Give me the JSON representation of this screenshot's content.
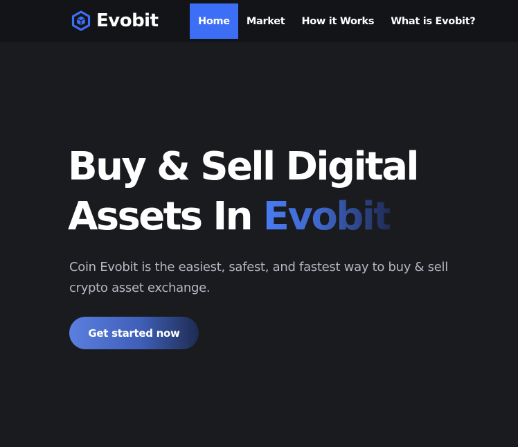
{
  "brand": {
    "name": "Evobit",
    "icon": "cube-icon",
    "accent_color": "#3d6ff6"
  },
  "nav": {
    "items": [
      {
        "label": "Home",
        "active": true
      },
      {
        "label": "Market",
        "active": false
      },
      {
        "label": "How it Works",
        "active": false
      },
      {
        "label": "What is Evobit?",
        "active": false
      }
    ]
  },
  "hero": {
    "title_line1": "Buy & Sell Digital",
    "title_line2_prefix": "Assets In ",
    "title_line2_accent": "Evobit",
    "description": "Coin Evobit is the easiest, safest, and fastest way to buy & sell crypto asset exchange.",
    "cta_label": "Get started now"
  },
  "colors": {
    "background": "#1a1b1f",
    "navbar_background": "#131417",
    "active_nav_background": "#3d6ff6"
  }
}
